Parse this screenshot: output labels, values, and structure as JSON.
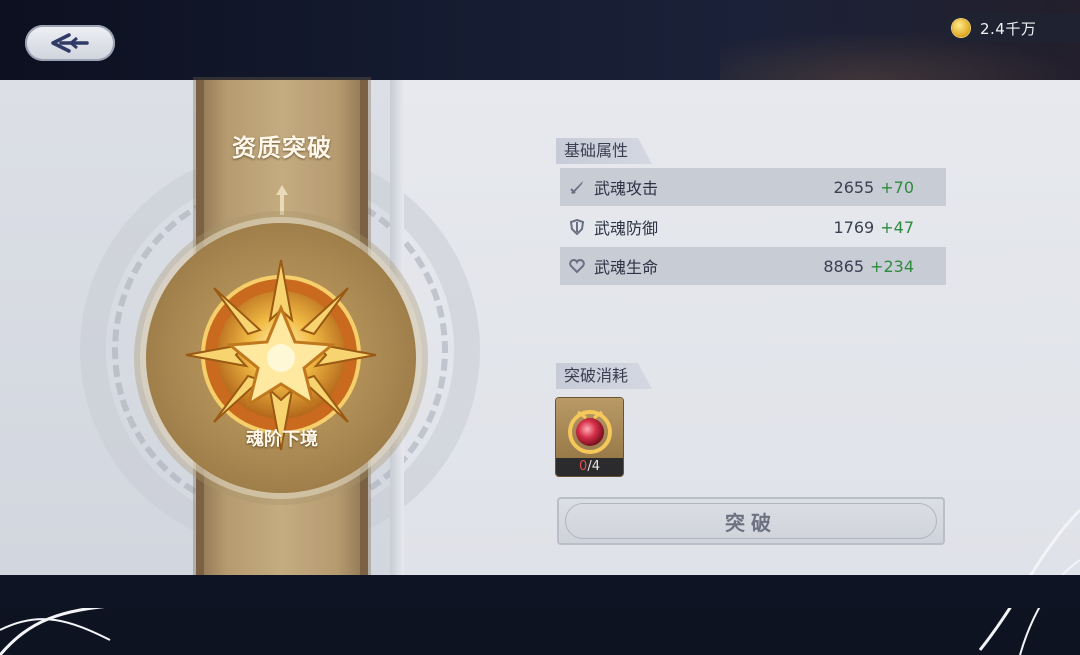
{
  "header": {
    "back_icon": "back-arrow-icon",
    "currency": {
      "icon": "gold-coin-icon",
      "amount": "2.4千万"
    }
  },
  "left": {
    "banner_title": "资质突破",
    "medal_icon": "golden-star-medal-icon",
    "medal_label": "魂阶下境"
  },
  "attributes": {
    "title": "基础属性",
    "rows": [
      {
        "icon": "sword-icon",
        "name": "武魂攻击",
        "value": "2655",
        "bonus": "+70"
      },
      {
        "icon": "shield-icon",
        "name": "武魂防御",
        "value": "1769",
        "bonus": "+47"
      },
      {
        "icon": "heart-icon",
        "name": "武魂生命",
        "value": "8865",
        "bonus": "+234"
      }
    ]
  },
  "cost": {
    "title": "突破消耗",
    "item": {
      "icon": "red-gem-orb-icon",
      "current": "0",
      "required": "/4"
    }
  },
  "action": {
    "break_label": "突破"
  },
  "colors": {
    "bonus_green": "#2e8a3e",
    "count_red": "#e0524a",
    "banner_gold": "#c4ab80"
  }
}
